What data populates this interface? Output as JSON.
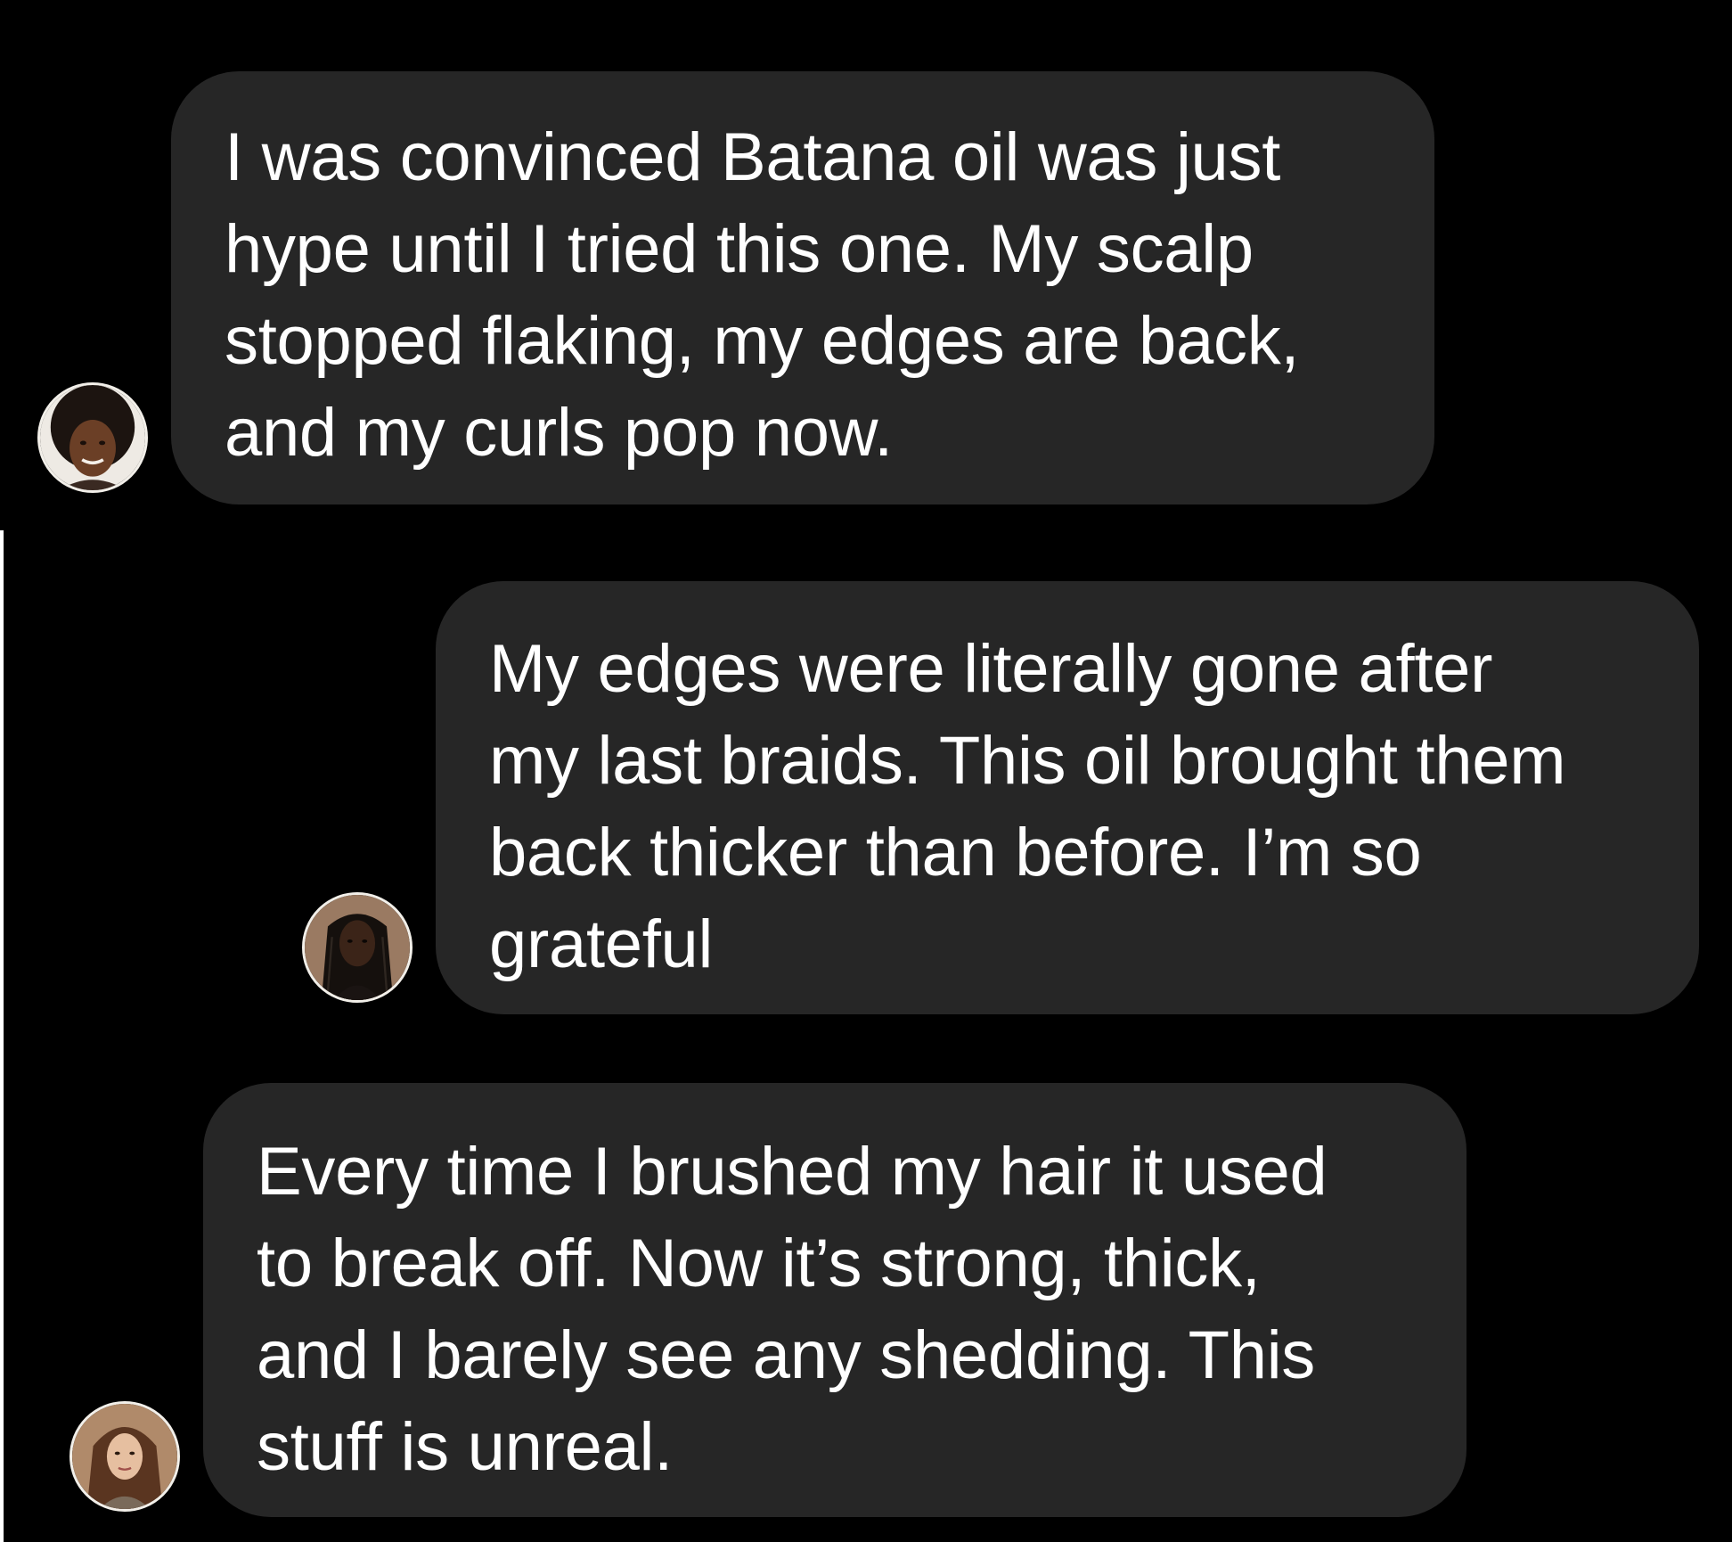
{
  "messages": [
    {
      "avatar": "woman-afro-avatar",
      "lines": [
        "I was convinced Batana oil was just",
        "hype until I tried this one. My scalp",
        "stopped flaking, my edges are back,",
        "and my curls pop now."
      ]
    },
    {
      "avatar": "woman-braids-avatar",
      "lines": [
        "My edges were literally gone after",
        "my last braids. This oil brought them",
        "back thicker than before. I’m so",
        "grateful"
      ]
    },
    {
      "avatar": "woman-wavy-hair-avatar",
      "lines": [
        "Every time I brushed my hair it used",
        "to break off. Now it’s strong, thick,",
        "and I barely see any shedding. This",
        "stuff is unreal."
      ]
    }
  ],
  "colors": {
    "background": "#000000",
    "bubble": "#262626",
    "text": "#ffffff"
  }
}
